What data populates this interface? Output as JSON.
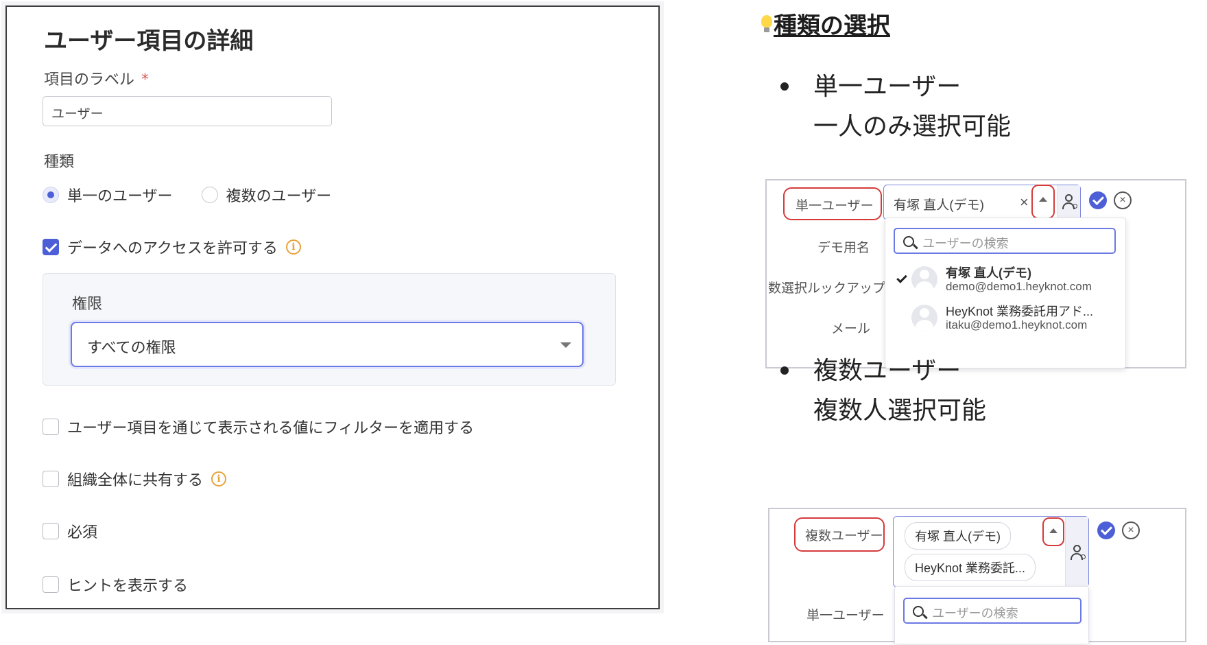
{
  "left_panel": {
    "title": "ユーザー項目の詳細",
    "label_field": {
      "label": "項目のラベル",
      "required_mark": "*",
      "value": "ユーザー"
    },
    "type_section": {
      "label": "種類",
      "options": [
        {
          "label": "単一のユーザー",
          "selected": true
        },
        {
          "label": "複数のユーザー",
          "selected": false
        }
      ]
    },
    "allow_access": {
      "label": "データへのアクセスを許可する",
      "checked": true
    },
    "permission": {
      "label": "権限",
      "value": "すべての権限"
    },
    "checkboxes": [
      {
        "label": "ユーザー項目を通じて表示される値にフィルターを適用する",
        "checked": false
      },
      {
        "label": "組織全体に共有する",
        "checked": false,
        "info": true
      },
      {
        "label": "必須",
        "checked": false
      },
      {
        "label": "ヒントを表示する",
        "checked": false
      }
    ],
    "accent_color": "#4c5fd6",
    "info_color": "#e8a23a"
  },
  "right_side": {
    "heading": "種類の選択",
    "bullets": [
      {
        "title": "単一ユーザー",
        "desc": "一人のみ選択可能"
      },
      {
        "title": "複数ユーザー",
        "desc": "複数人選択可能"
      }
    ],
    "shot1": {
      "field_label": "単一ユーザー",
      "row_labels": [
        "デモ用名",
        "数選択ルックアップ",
        "メール"
      ],
      "field_value": "有塚 直人(デモ)",
      "clear": "×",
      "close": "×",
      "search_placeholder": "ユーザーの検索",
      "users": [
        {
          "name": "有塚 直人(デモ)",
          "email": "demo@demo1.heyknot.com",
          "selected": true
        },
        {
          "name": "HeyKnot 業務委託用アド...",
          "email": "itaku@demo1.heyknot.com",
          "selected": false
        }
      ]
    },
    "shot2": {
      "field_label": "複数ユーザー",
      "row_label": "単一ユーザー",
      "chips": [
        "有塚 直人(デモ)",
        "HeyKnot 業務委託..."
      ],
      "close": "×",
      "search_placeholder": "ユーザーの検索"
    },
    "highlight_color": "#d53a3a"
  }
}
